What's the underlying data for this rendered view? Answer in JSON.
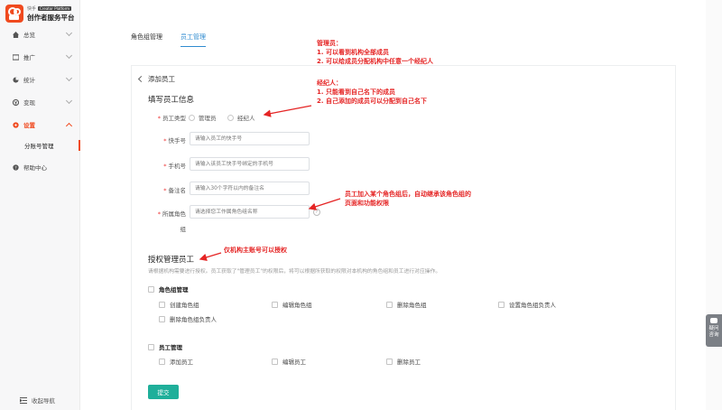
{
  "brand": {
    "small": "快手",
    "tag": "Creator Platform",
    "name": "创作者服务平台"
  },
  "nav": [
    {
      "label": "总览",
      "icon": "home-icon"
    },
    {
      "label": "推广",
      "icon": "folder-icon"
    },
    {
      "label": "统计",
      "icon": "chart-icon"
    },
    {
      "label": "变现",
      "icon": "money-icon"
    },
    {
      "label": "设置",
      "icon": "gear-icon"
    },
    {
      "label": "分账号管理"
    },
    {
      "label": "帮助中心",
      "icon": "help-icon"
    }
  ],
  "collapse_label": "收起导航",
  "tabs": [
    "角色组管理",
    "员工管理"
  ],
  "page": {
    "back_label": "添加员工",
    "section1": "填写员工信息",
    "employee_type_label": "员工类型",
    "radio_admin": "管理员",
    "radio_agent": "经纪人",
    "kuaishou_label": "快手号",
    "kuaishou_placeholder": "请输入员工的快手号",
    "phone_label": "手机号",
    "phone_placeholder": "请输入该员工快手号绑定的手机号",
    "remark_label": "备注名",
    "remark_placeholder": "请输入30个字符以内的备注名",
    "role_label": "所属角色",
    "role_label2": "组",
    "role_placeholder": "请选择您工作属角色组名称",
    "section2": "授权管理员工",
    "section2_desc": "请根据机构需要进行授权。员工获取了\"管理员工\"的权限后，将可以根据所获取的权限对本机构的角色组和员工进行对应操作。",
    "group1_title": "角色组管理",
    "group1_items": [
      "创建角色组",
      "编辑角色组",
      "删除角色组",
      "设置角色组负责人",
      "删除角色组负责人"
    ],
    "group2_title": "员工管理",
    "group2_items": [
      "添加员工",
      "编辑员工",
      "删除员工"
    ],
    "submit_label": "提交"
  },
  "annotations": {
    "a1_title": "管理员：",
    "a1_l1": "1. 可以看到机构全部成员",
    "a1_l2": "2. 可以给成员分配机构中任意一个经纪人",
    "a2_title": "经纪人：",
    "a2_l1": "1. 只能看到自己名下的成员",
    "a2_l2": "2. 自己添加的成员可以分配到自己名下",
    "a3_l1": "员工加入某个角色组后，自动继承该角色组的",
    "a3_l2": "页面和功能权限",
    "a4": "仅机构主账号可以授权"
  },
  "float_label": [
    "疑问",
    "咨询"
  ],
  "colors": {
    "accent": "#f04a1f",
    "tab": "#2f8bd0",
    "submit": "#1faf9a",
    "annotation": "#e52525"
  }
}
